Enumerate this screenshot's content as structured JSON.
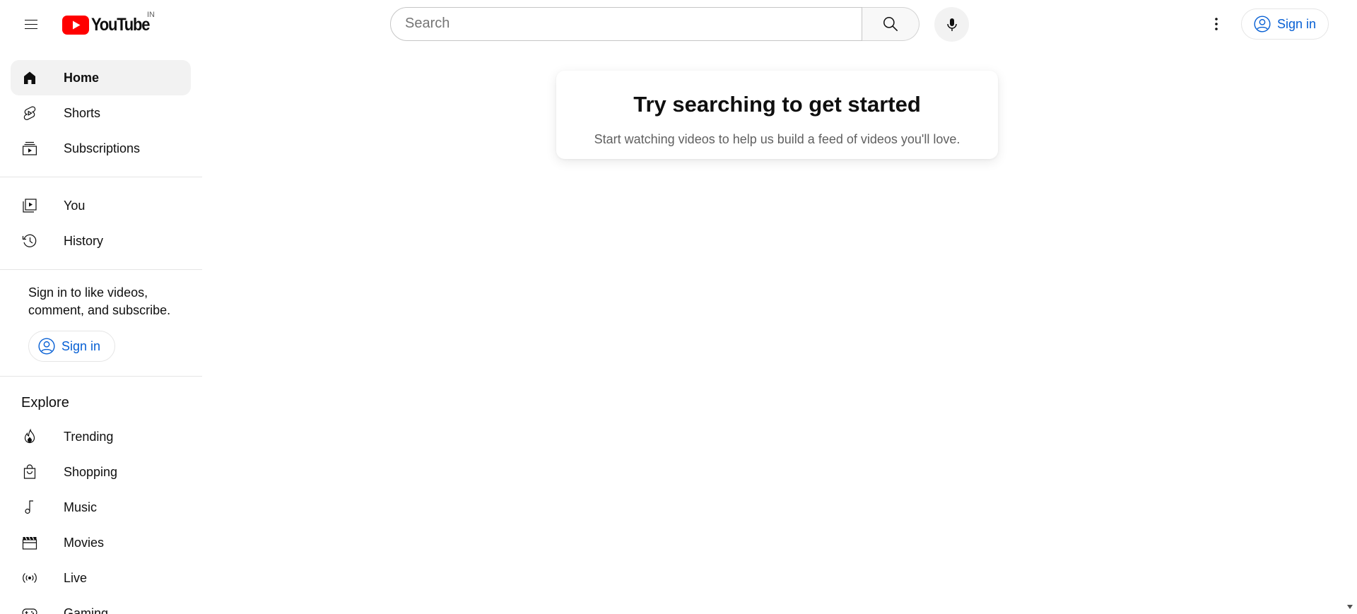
{
  "header": {
    "menu_icon": "hamburger-menu-icon",
    "logo_text": "YouTube",
    "country_code": "IN",
    "search_placeholder": "Search",
    "search_value": "",
    "search_icon": "search-icon",
    "mic_icon": "microphone-icon",
    "more_icon": "vertical-dots-icon",
    "signin_label": "Sign in",
    "signin_icon": "account-circle-icon"
  },
  "sidebar": {
    "primary": [
      {
        "label": "Home",
        "icon": "home-icon",
        "active": true
      },
      {
        "label": "Shorts",
        "icon": "shorts-icon",
        "active": false
      },
      {
        "label": "Subscriptions",
        "icon": "subscriptions-icon",
        "active": false
      }
    ],
    "secondary": [
      {
        "label": "You",
        "icon": "your-channel-icon"
      },
      {
        "label": "History",
        "icon": "history-icon"
      }
    ],
    "signin_prompt": "Sign in to like videos, comment, and subscribe.",
    "signin_label": "Sign in",
    "explore_title": "Explore",
    "explore": [
      {
        "label": "Trending",
        "icon": "trending-flame-icon"
      },
      {
        "label": "Shopping",
        "icon": "shopping-bag-icon"
      },
      {
        "label": "Music",
        "icon": "music-note-icon"
      },
      {
        "label": "Movies",
        "icon": "clapperboard-icon"
      },
      {
        "label": "Live",
        "icon": "live-broadcast-icon"
      },
      {
        "label": "Gaming",
        "icon": "gamepad-icon"
      }
    ]
  },
  "main": {
    "empty_title": "Try searching to get started",
    "empty_subtitle": "Start watching videos to help us build a feed of videos you'll love."
  },
  "colors": {
    "brand_red": "#ff0000",
    "link_blue": "#065fd4",
    "active_bg": "#f2f2f2",
    "text_primary": "#0f0f0f",
    "text_secondary": "#606060"
  }
}
